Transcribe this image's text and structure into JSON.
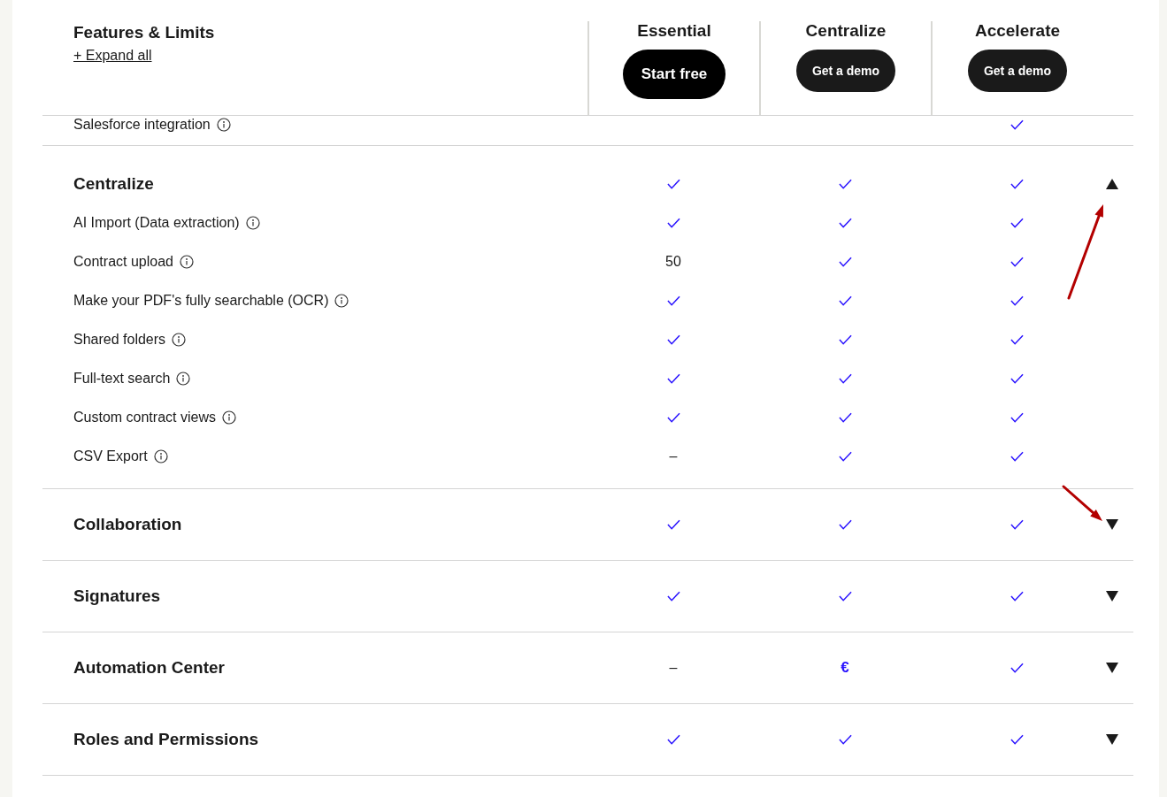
{
  "header": {
    "title": "Features & Limits",
    "expand_link": "+ Expand all",
    "plans": [
      {
        "name": "Essential",
        "button": "Start free",
        "primary": true
      },
      {
        "name": "Centralize",
        "button": "Get a demo",
        "primary": false
      },
      {
        "name": "Accelerate",
        "button": "Get a demo",
        "primary": false
      }
    ]
  },
  "partial_row": {
    "label": "Salesforce integration",
    "info": true,
    "cells": [
      {
        "kind": "blank"
      },
      {
        "kind": "blank"
      },
      {
        "kind": "check"
      }
    ]
  },
  "sections": [
    {
      "title": "Centralize",
      "expanded": true,
      "arrow": {
        "kind": "from-below"
      },
      "cells": [
        {
          "kind": "check"
        },
        {
          "kind": "check"
        },
        {
          "kind": "check"
        }
      ],
      "rows": [
        {
          "label": "AI Import (Data extraction)",
          "info": true,
          "cells": [
            {
              "kind": "check"
            },
            {
              "kind": "check"
            },
            {
              "kind": "check"
            }
          ]
        },
        {
          "label": "Contract upload",
          "info": true,
          "cells": [
            {
              "kind": "text",
              "text": "50"
            },
            {
              "kind": "check"
            },
            {
              "kind": "check"
            }
          ]
        },
        {
          "label": "Make your PDF's fully searchable (OCR)",
          "info": true,
          "cells": [
            {
              "kind": "check"
            },
            {
              "kind": "check"
            },
            {
              "kind": "check"
            }
          ]
        },
        {
          "label": "Shared folders",
          "info": true,
          "cells": [
            {
              "kind": "check"
            },
            {
              "kind": "check"
            },
            {
              "kind": "check"
            }
          ]
        },
        {
          "label": "Full-text search",
          "info": true,
          "cells": [
            {
              "kind": "check"
            },
            {
              "kind": "check"
            },
            {
              "kind": "check"
            }
          ]
        },
        {
          "label": "Custom contract views",
          "info": true,
          "cells": [
            {
              "kind": "check"
            },
            {
              "kind": "check"
            },
            {
              "kind": "check"
            }
          ]
        },
        {
          "label": "CSV Export",
          "info": true,
          "cells": [
            {
              "kind": "text",
              "text": "–"
            },
            {
              "kind": "check"
            },
            {
              "kind": "check"
            }
          ]
        }
      ]
    },
    {
      "title": "Collaboration",
      "expanded": false,
      "arrow": {
        "kind": "from-upper-left"
      },
      "cells": [
        {
          "kind": "check"
        },
        {
          "kind": "check"
        },
        {
          "kind": "check"
        }
      ]
    },
    {
      "title": "Signatures",
      "expanded": false,
      "cells": [
        {
          "kind": "check"
        },
        {
          "kind": "check"
        },
        {
          "kind": "check"
        }
      ]
    },
    {
      "title": "Automation Center",
      "expanded": false,
      "cells": [
        {
          "kind": "text",
          "text": "–"
        },
        {
          "kind": "accent",
          "text": "€"
        },
        {
          "kind": "check"
        }
      ]
    },
    {
      "title": "Roles and Permissions",
      "expanded": false,
      "cells": [
        {
          "kind": "check"
        },
        {
          "kind": "check"
        },
        {
          "kind": "check"
        }
      ]
    }
  ]
}
